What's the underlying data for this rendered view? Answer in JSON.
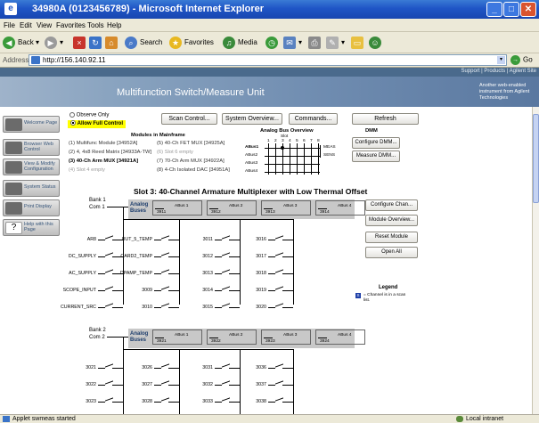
{
  "window": {
    "title": "34980A (0123456789) - Microsoft Internet Explorer"
  },
  "menu": {
    "items": [
      "File",
      "Edit",
      "View",
      "Favorites",
      "Tools",
      "Help"
    ]
  },
  "toolbar": {
    "back": "Back",
    "search": "Search",
    "favorites": "Favorites",
    "media": "Media"
  },
  "address": {
    "label": "Address",
    "url": "http://156.140.92.11",
    "go": "Go"
  },
  "header": {
    "top_links": "Support | Products | Agilent Site",
    "title": "Multifunction Switch/Measure Unit",
    "brand": "Another web-enabled instrument from Agilent Technologies"
  },
  "sidebar": {
    "items": [
      "Welcome Page",
      "Browser Web Control",
      "View & Modify Configuration",
      "System Status",
      "Print Display",
      "Help with this Page"
    ]
  },
  "control": {
    "observe": "Observe Only",
    "full": "Allow Full Control",
    "scan_button": "Scan Control...",
    "overview_button": "System Overview...",
    "commands_button": "Commands...",
    "refresh_button": "Refresh"
  },
  "mainframe": {
    "title": "Modules in Mainframe",
    "modules": [
      "(1) Multifunc Module [34952A]",
      "(2) 4, 4x8 Reed Matrix [34933A-TW]",
      "(3) 40-Ch Arm MUX [34921A]",
      "(4) Slot 4 empty",
      "(5) 40-Ch FET MUX [34925A]",
      "(6) Slot 6 empty",
      "(7) 70-Ch Arm MUX [34922A]",
      "(8) 4-Ch Isolated DAC [34951A]"
    ]
  },
  "analog": {
    "title": "Analog Bus Overview",
    "slot_label": "Slot",
    "slots": [
      "1",
      "2",
      "3",
      "4",
      "5",
      "6",
      "7",
      "8"
    ],
    "buses": [
      "ABus1",
      "ABus2",
      "ABus3",
      "ABus4"
    ],
    "meas": "MEAS",
    "sens": "SENS"
  },
  "dmm": {
    "title": "DMM",
    "configure": "Configure DMM...",
    "measure": "Measure DMM..."
  },
  "slot": {
    "title": "Slot 3: 40-Channel Armature Multiplexer with Low Thermal Offset"
  },
  "right_buttons": {
    "configure": "Configure Chan...",
    "overview": "Module Overview...",
    "reset": "Reset Module",
    "open_all": "Open All"
  },
  "legend": {
    "title": "Legend",
    "text": "= Channel is in a scan list.",
    "mark": "S"
  },
  "bank1": {
    "name1": "Bank 1",
    "name2": "Com 1",
    "bus_label1": "Analog",
    "bus_label2": "Buses",
    "abus": [
      {
        "n": "3911",
        "l": "ABus 1"
      },
      {
        "n": "3912",
        "l": "ABus 2"
      },
      {
        "n": "3913",
        "l": "ABus 3"
      },
      {
        "n": "3914",
        "l": "ABus 4"
      }
    ],
    "col1": [
      "AR8",
      "DC_SUPPLY",
      "AC_SUPPLY",
      "SCOPE_INPUT",
      "CURRENT_SRC"
    ],
    "col2": [
      "UUT_5_TEMP",
      "CARD2_TEMP",
      "DPAMP_TEMP",
      "3009",
      "3010"
    ],
    "col3": [
      "3011",
      "3012",
      "3013",
      "3014",
      "3015"
    ],
    "col4": [
      "3016",
      "3017",
      "3018",
      "3019",
      "3020"
    ]
  },
  "bank2": {
    "name1": "Bank 2",
    "name2": "Com 2",
    "bus_label1": "Analog",
    "bus_label2": "Buses",
    "abus": [
      {
        "n": "3921",
        "l": "ABus 1"
      },
      {
        "n": "3922",
        "l": "ABus 2"
      },
      {
        "n": "3923",
        "l": "ABus 3"
      },
      {
        "n": "3924",
        "l": "ABus 4"
      }
    ],
    "col1": [
      "3021",
      "3022",
      "3023"
    ],
    "col2": [
      "3026",
      "3027",
      "3028"
    ],
    "col3": [
      "3031",
      "3032",
      "3033"
    ],
    "col4": [
      "3036",
      "3037",
      "3038"
    ]
  },
  "status": {
    "left": "Applet swmeas started",
    "right": "Local intranet"
  }
}
